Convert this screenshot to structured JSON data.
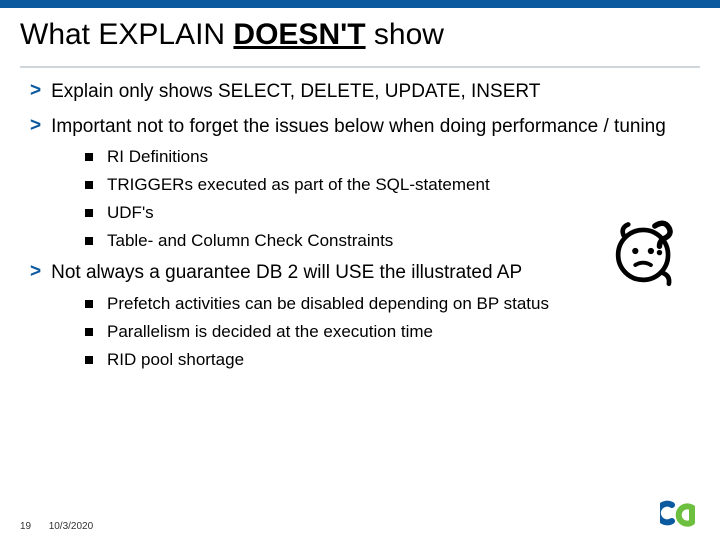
{
  "title": {
    "pre": "What EXPLAIN ",
    "underline": "DOESN'T",
    "post": " show"
  },
  "bullets": [
    {
      "text": "Explain only shows SELECT, DELETE, UPDATE, INSERT",
      "sub": []
    },
    {
      "text": "Important not to forget the issues below when doing performance / tuning",
      "sub": [
        "RI Definitions",
        "TRIGGERs executed as part of the SQL-statement",
        "UDF's",
        "Table- and Column Check Constraints"
      ]
    },
    {
      "text": "Not always a guarantee DB 2 will USE the illustrated AP",
      "sub": [
        "Prefetch activities can be disabled depending on BP status",
        "Parallelism is decided at the execution time",
        "RID pool shortage"
      ]
    }
  ],
  "footer": {
    "page": "19",
    "date": "10/3/2020"
  },
  "logo": {
    "name": "ca-logo"
  },
  "decoration": {
    "name": "question-face-icon"
  }
}
